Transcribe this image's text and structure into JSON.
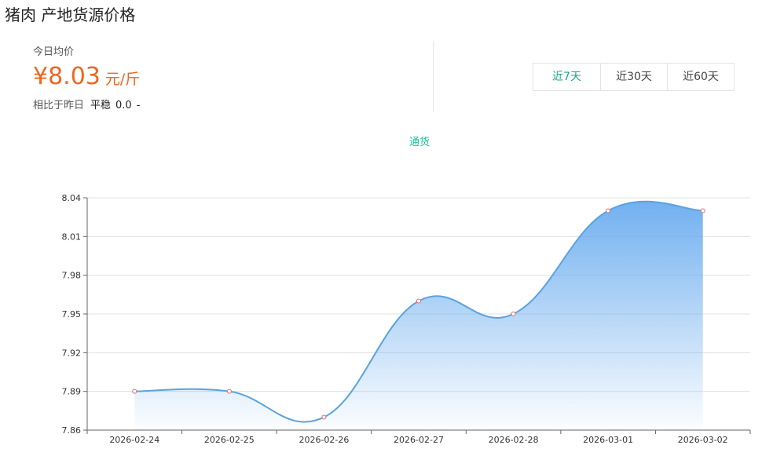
{
  "page": {
    "title": "猪肉 产地货源价格"
  },
  "summary": {
    "label": "今日均价",
    "price": "¥8.03",
    "unit": "元/斤",
    "compare_label": "相比于昨日",
    "status": "平稳",
    "delta": "0.0",
    "sign": "-"
  },
  "range_tabs": [
    {
      "label": "近7天",
      "active": true
    },
    {
      "label": "近30天",
      "active": false
    },
    {
      "label": "近60天",
      "active": false
    }
  ],
  "colors": {
    "accent": "#1ec09a",
    "price": "#f0661e",
    "line": "#5aa3df",
    "fill": "#6aacef",
    "point": "#e06a6a"
  },
  "chart_data": {
    "type": "area",
    "x": [
      "2026-02-24",
      "2026-02-25",
      "2026-02-26",
      "2026-02-27",
      "2026-02-28",
      "2026-03-01",
      "2026-03-02"
    ],
    "series": [
      {
        "name": "通货",
        "values": [
          7.89,
          7.89,
          7.87,
          7.96,
          7.95,
          8.03,
          8.03
        ]
      }
    ],
    "ylim": [
      7.86,
      8.04
    ],
    "yticks": [
      "7.86",
      "7.89",
      "7.92",
      "7.95",
      "7.98",
      "8.01",
      "8.04"
    ],
    "grid": true,
    "smooth": true,
    "legend": "top-center"
  }
}
